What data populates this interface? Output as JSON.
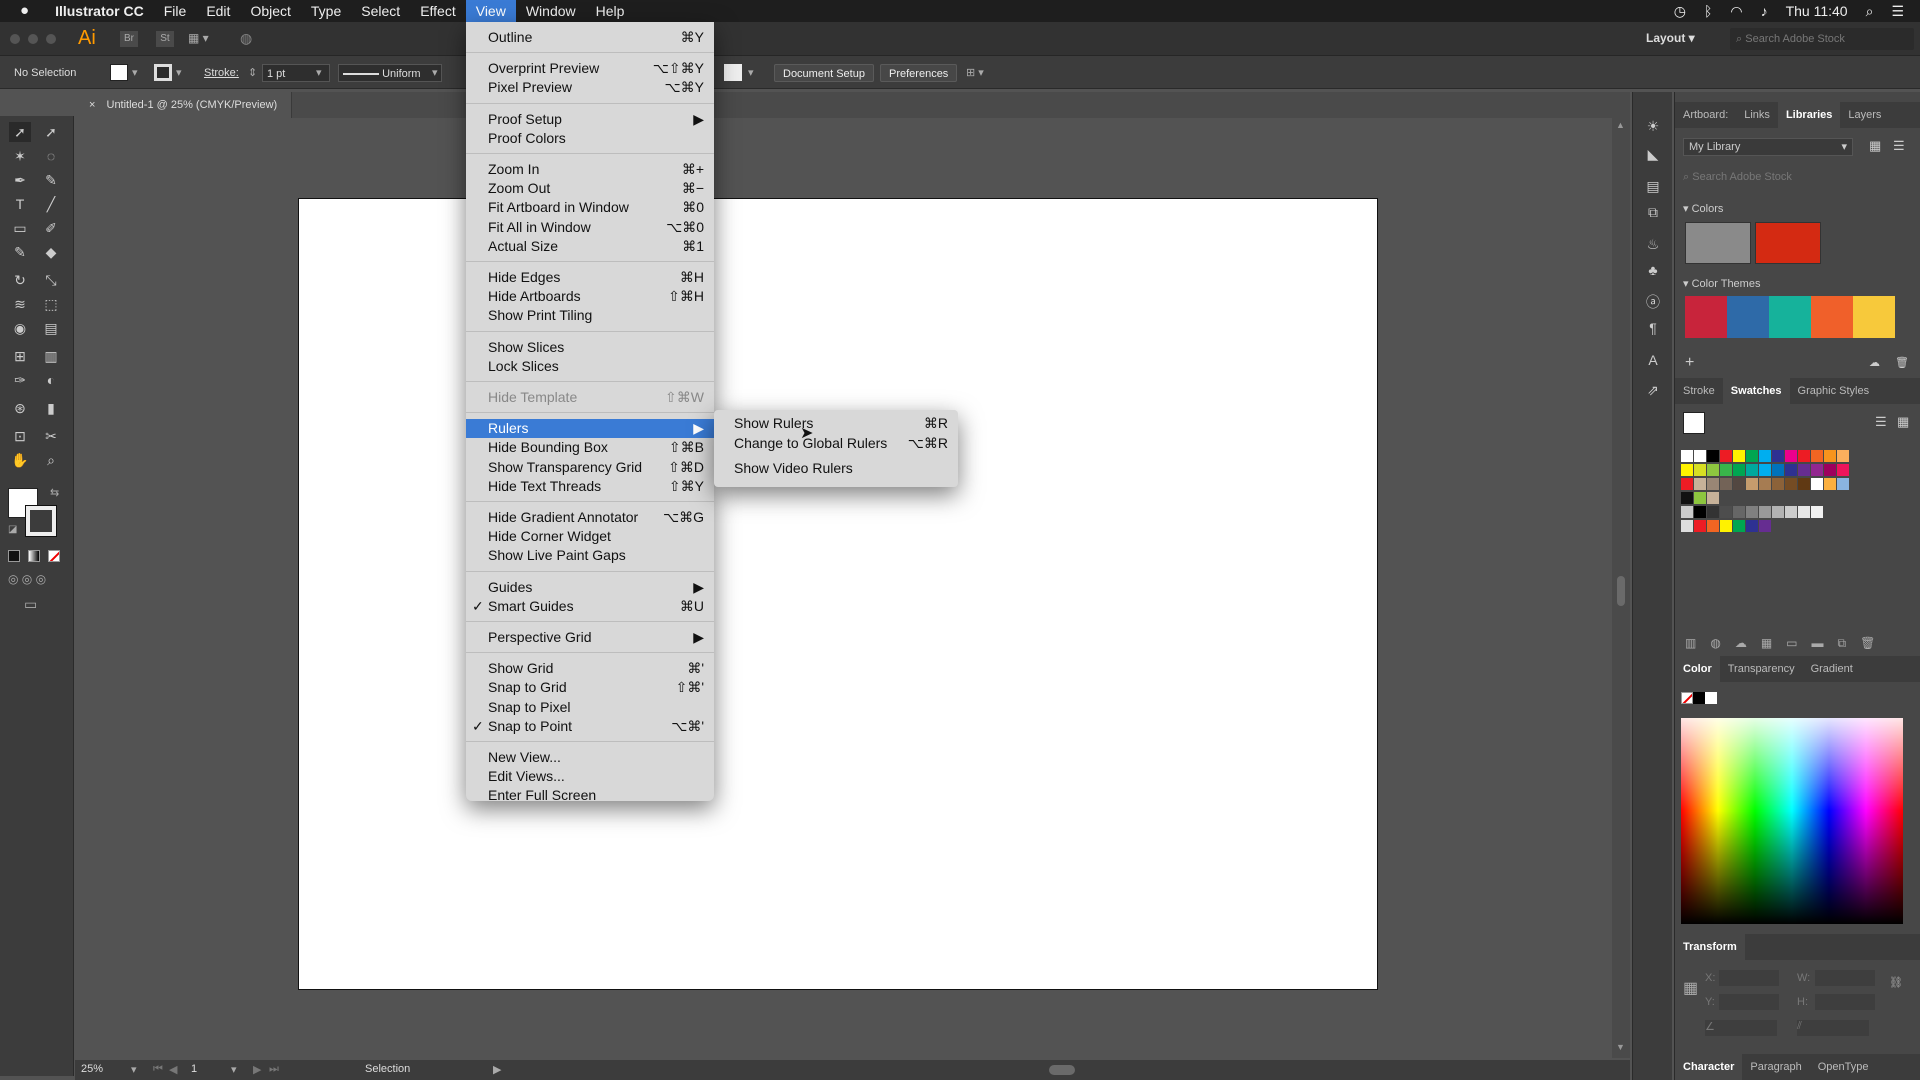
{
  "menubar": {
    "items": [
      "Illustrator CC",
      "File",
      "Edit",
      "Object",
      "Type",
      "Select",
      "Effect",
      "View",
      "Window",
      "Help"
    ],
    "clock": "Thu 11:40"
  },
  "appbar": {
    "logo": "Ai",
    "br": "Br",
    "st": "St",
    "layout": "Layout",
    "search_placeholder": "Search Adobe Stock"
  },
  "control": {
    "selection": "No Selection",
    "stroke_label": "Stroke:",
    "stroke_value": "1 pt",
    "profile": "Uniform",
    "doc_setup": "Document Setup",
    "preferences": "Preferences"
  },
  "doc_tab": {
    "close": "×",
    "title": "Untitled-1 @ 25% (CMYK/Preview)"
  },
  "status": {
    "zoom": "25%",
    "page": "1",
    "tool": "Selection"
  },
  "panels": {
    "top_tabs": [
      "Artboard:",
      "Links",
      "Libraries",
      "Layers"
    ],
    "library": "My Library",
    "library_search": "Search Adobe Stock",
    "colors_label": "Colors",
    "themes_label": "Color Themes",
    "mid_tabs": [
      "Stroke",
      "Swatches",
      "Graphic Styles"
    ],
    "color_tabs": [
      "Color",
      "Transparency",
      "Gradient"
    ],
    "transform_label": "Transform",
    "transform_x": "X:",
    "transform_y": "Y:",
    "transform_w": "W:",
    "transform_h": "H:",
    "bottom_tabs": [
      "Character",
      "Paragraph",
      "OpenType"
    ]
  },
  "view_menu": {
    "items": [
      {
        "label": "Outline",
        "shortcut": "⌘Y"
      },
      {
        "sep": true
      },
      {
        "label": "Overprint Preview",
        "shortcut": "⌥⇧⌘Y"
      },
      {
        "label": "Pixel Preview",
        "shortcut": "⌥⌘Y"
      },
      {
        "sep": true
      },
      {
        "label": "Proof Setup",
        "shortcut": "▶"
      },
      {
        "label": "Proof Colors",
        "shortcut": ""
      },
      {
        "sep": true
      },
      {
        "label": "Zoom In",
        "shortcut": "⌘+"
      },
      {
        "label": "Zoom Out",
        "shortcut": "⌘−"
      },
      {
        "label": "Fit Artboard in Window",
        "shortcut": "⌘0"
      },
      {
        "label": "Fit All in Window",
        "shortcut": "⌥⌘0"
      },
      {
        "label": "Actual Size",
        "shortcut": "⌘1"
      },
      {
        "sep": true
      },
      {
        "label": "Hide Edges",
        "shortcut": "⌘H"
      },
      {
        "label": "Hide Artboards",
        "shortcut": "⇧⌘H"
      },
      {
        "label": "Show Print Tiling",
        "shortcut": ""
      },
      {
        "sep": true
      },
      {
        "label": "Show Slices",
        "shortcut": ""
      },
      {
        "label": "Lock Slices",
        "shortcut": ""
      },
      {
        "sep": true
      },
      {
        "label": "Hide Template",
        "shortcut": "⇧⌘W",
        "disabled": true
      },
      {
        "sep": true
      },
      {
        "label": "Rulers",
        "shortcut": "▶",
        "highlighted": true
      },
      {
        "label": "Hide Bounding Box",
        "shortcut": "⇧⌘B"
      },
      {
        "label": "Show Transparency Grid",
        "shortcut": "⇧⌘D"
      },
      {
        "label": "Hide Text Threads",
        "shortcut": "⇧⌘Y"
      },
      {
        "sep": true
      },
      {
        "label": "Hide Gradient Annotator",
        "shortcut": "⌥⌘G"
      },
      {
        "label": "Hide Corner Widget",
        "shortcut": ""
      },
      {
        "label": "Show Live Paint Gaps",
        "shortcut": ""
      },
      {
        "sep": true
      },
      {
        "label": "Guides",
        "shortcut": "▶"
      },
      {
        "label": "Smart Guides",
        "shortcut": "⌘U",
        "checked": true
      },
      {
        "sep": true
      },
      {
        "label": "Perspective Grid",
        "shortcut": "▶"
      },
      {
        "sep": true
      },
      {
        "label": "Show Grid",
        "shortcut": "⌘'"
      },
      {
        "label": "Snap to Grid",
        "shortcut": "⇧⌘'"
      },
      {
        "label": "Snap to Pixel",
        "shortcut": ""
      },
      {
        "label": "Snap to Point",
        "shortcut": "⌥⌘'",
        "checked": true
      },
      {
        "sep": true
      },
      {
        "label": "New View...",
        "shortcut": ""
      },
      {
        "label": "Edit Views...",
        "shortcut": ""
      },
      {
        "label": "Enter Full Screen",
        "shortcut": ""
      }
    ]
  },
  "rulers_submenu": {
    "items": [
      {
        "label": "Show Rulers",
        "shortcut": "⌘R"
      },
      {
        "label": "Change to Global Rulers",
        "shortcut": "⌥⌘R"
      },
      {
        "sep": true
      },
      {
        "label": "Show Video Rulers",
        "shortcut": ""
      }
    ]
  },
  "colors": {
    "accent": "#3a7bd5",
    "library_swatch_1": "#8a8a8a",
    "library_swatch_2": "#d42a12",
    "themes": [
      "#c8243b",
      "#2e6aa8",
      "#16b29b",
      "#f0602a",
      "#f7c93b"
    ]
  }
}
